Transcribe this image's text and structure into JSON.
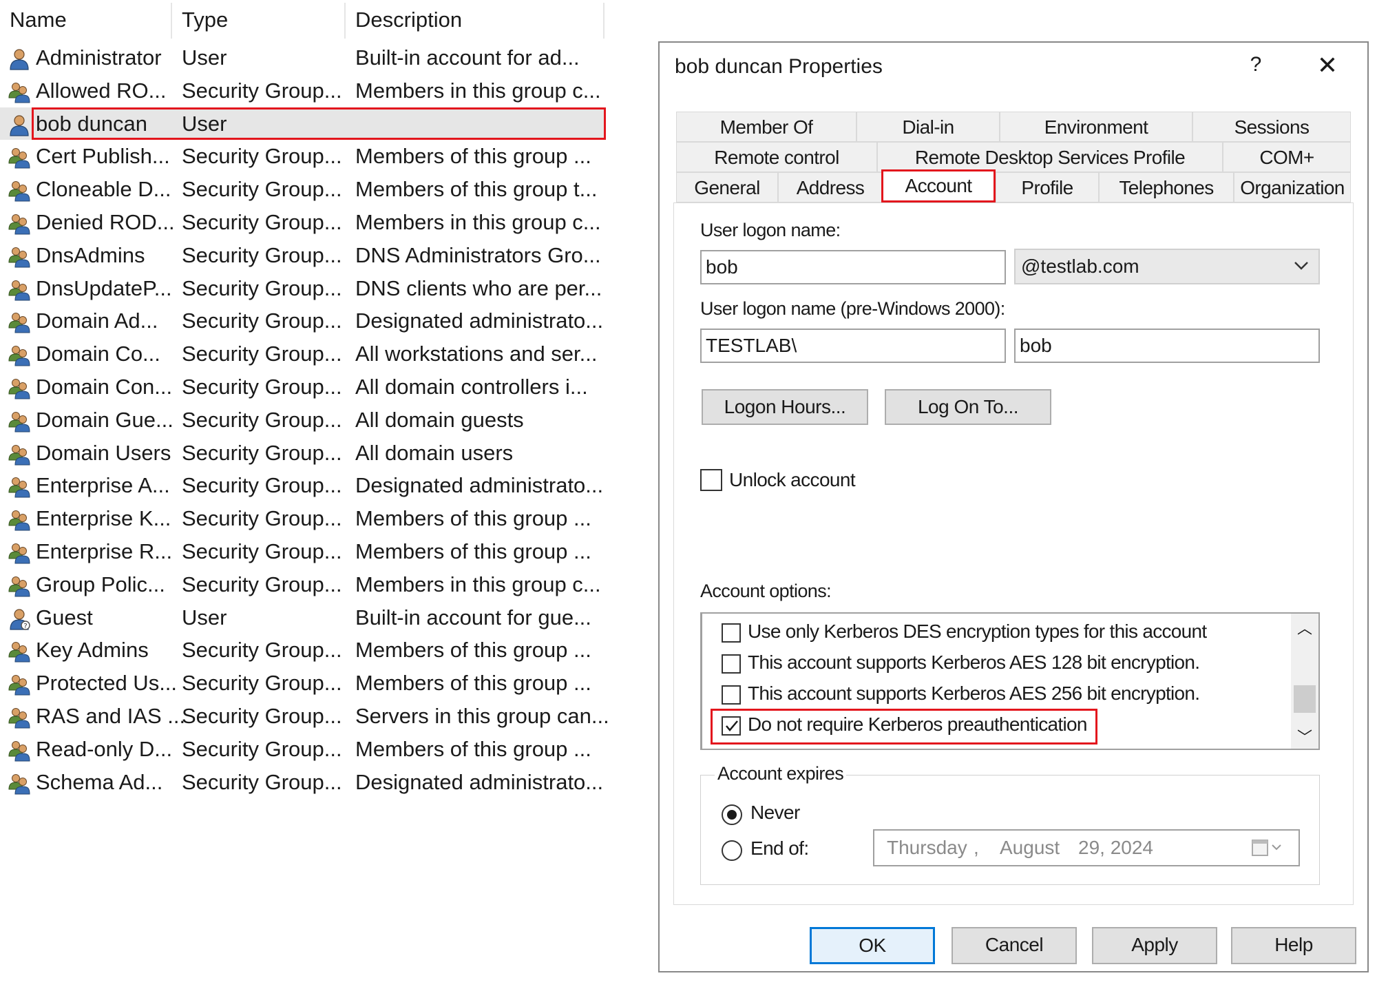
{
  "list": {
    "columns": {
      "name": "Name",
      "type": "Type",
      "description": "Description"
    },
    "rows": [
      {
        "name": "Administrator",
        "type": "User",
        "description": "Built-in account for ad...",
        "icon": "user-icon"
      },
      {
        "name": "Allowed RO...",
        "type": "Security Group...",
        "description": "Members in this group c...",
        "icon": "group-icon"
      },
      {
        "name": "bob duncan",
        "type": "User",
        "description": "",
        "icon": "user-icon"
      },
      {
        "name": "Cert Publish...",
        "type": "Security Group...",
        "description": "Members of this group ...",
        "icon": "group-icon"
      },
      {
        "name": "Cloneable D...",
        "type": "Security Group...",
        "description": "Members of this group t...",
        "icon": "group-icon"
      },
      {
        "name": "Denied ROD...",
        "type": "Security Group...",
        "description": "Members in this group c...",
        "icon": "group-icon"
      },
      {
        "name": "DnsAdmins",
        "type": "Security Group...",
        "description": "DNS Administrators Gro...",
        "icon": "group-icon"
      },
      {
        "name": "DnsUpdateP...",
        "type": "Security Group...",
        "description": "DNS clients who are per...",
        "icon": "group-icon"
      },
      {
        "name": "Domain Ad...",
        "type": "Security Group...",
        "description": "Designated administrato...",
        "icon": "group-icon"
      },
      {
        "name": "Domain Co...",
        "type": "Security Group...",
        "description": "All workstations and ser...",
        "icon": "group-icon"
      },
      {
        "name": "Domain Con...",
        "type": "Security Group...",
        "description": "All domain controllers i...",
        "icon": "group-icon"
      },
      {
        "name": "Domain Gue...",
        "type": "Security Group...",
        "description": "All domain guests",
        "icon": "group-icon"
      },
      {
        "name": "Domain Users",
        "type": "Security Group...",
        "description": "All domain users",
        "icon": "group-icon"
      },
      {
        "name": "Enterprise A...",
        "type": "Security Group...",
        "description": "Designated administrato...",
        "icon": "group-icon"
      },
      {
        "name": "Enterprise K...",
        "type": "Security Group...",
        "description": "Members of this group ...",
        "icon": "group-icon"
      },
      {
        "name": "Enterprise R...",
        "type": "Security Group...",
        "description": "Members of this group ...",
        "icon": "group-icon"
      },
      {
        "name": "Group Polic...",
        "type": "Security Group...",
        "description": "Members in this group c...",
        "icon": "group-icon"
      },
      {
        "name": "Guest",
        "type": "User",
        "description": "Built-in account for gue...",
        "icon": "guest-user-icon"
      },
      {
        "name": "Key Admins",
        "type": "Security Group...",
        "description": "Members of this group ...",
        "icon": "group-icon"
      },
      {
        "name": "Protected Us...",
        "type": "Security Group...",
        "description": "Members of this group ...",
        "icon": "group-icon"
      },
      {
        "name": "RAS and IAS ...",
        "type": "Security Group...",
        "description": "Servers in this group can...",
        "icon": "group-icon"
      },
      {
        "name": "Read-only D...",
        "type": "Security Group...",
        "description": "Members of this group ...",
        "icon": "group-icon"
      },
      {
        "name": "Schema Ad...",
        "type": "Security Group...",
        "description": "Designated administrato...",
        "icon": "group-icon"
      }
    ]
  },
  "dialog": {
    "title": "bob duncan Properties",
    "help_label": "?",
    "close_label": "✕",
    "tabs_row1": [
      "Member Of",
      "Dial-in",
      "Environment",
      "Sessions"
    ],
    "tabs_row2": [
      "Remote control",
      "Remote Desktop Services Profile",
      "COM+"
    ],
    "tabs_row3": [
      "General",
      "Address",
      "Account",
      "Profile",
      "Telephones",
      "Organization"
    ],
    "active_tab": "Account",
    "logon_label": "User logon name:",
    "logon_value": "bob",
    "domain_value": "@testlab.com",
    "prewin_label": "User logon name (pre-Windows 2000):",
    "prewin_domain": "TESTLAB\\",
    "prewin_user": "bob",
    "logon_hours_label": "Logon Hours...",
    "log_on_to_label": "Log On To...",
    "unlock_label": "Unlock account",
    "account_options_label": "Account options:",
    "options": [
      {
        "label": "Use only Kerberos DES encryption types for this account",
        "checked": false
      },
      {
        "label": "This account supports Kerberos AES 128 bit encryption.",
        "checked": false
      },
      {
        "label": "This account supports Kerberos AES 256 bit encryption.",
        "checked": false
      },
      {
        "label": "Do not require Kerberos preauthentication",
        "checked": true
      }
    ],
    "expires_label": "Account expires",
    "never_label": "Never",
    "endof_label": "End of:",
    "date": {
      "day": "Thursday",
      "sep": ",",
      "month": "August",
      "rest": "29, 2024"
    },
    "ok_label": "OK",
    "cancel_label": "Cancel",
    "apply_label": "Apply",
    "help_button_label": "Help"
  },
  "colors": {
    "highlight": "#e3161d",
    "default_button": "#0078d7"
  }
}
